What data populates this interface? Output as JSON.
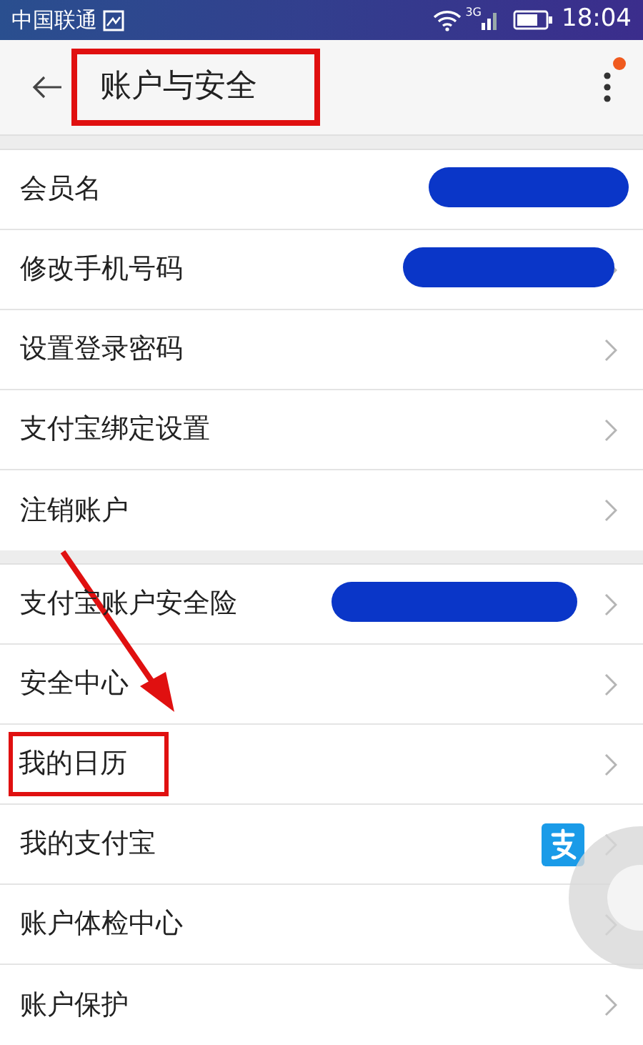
{
  "status_bar": {
    "carrier": "中国联通",
    "network": "3G",
    "time": "18:04"
  },
  "header": {
    "title": "账户与安全",
    "title_highlighted": true,
    "menu_badge": true
  },
  "groups": [
    {
      "rows": [
        {
          "label": "会员名",
          "redacted": true,
          "chevron": false,
          "highlighted": false,
          "alipay_icon": false
        },
        {
          "label": "修改手机号码",
          "redacted": true,
          "chevron": true,
          "highlighted": false,
          "alipay_icon": false
        },
        {
          "label": "设置登录密码",
          "redacted": false,
          "chevron": true,
          "highlighted": false,
          "alipay_icon": false
        },
        {
          "label": "支付宝绑定设置",
          "redacted": false,
          "chevron": true,
          "highlighted": false,
          "alipay_icon": false
        },
        {
          "label": "注销账户",
          "redacted": false,
          "chevron": true,
          "highlighted": false,
          "alipay_icon": false
        }
      ]
    },
    {
      "rows": [
        {
          "label": "支付宝账户安全险",
          "redacted": true,
          "chevron": true,
          "highlighted": false,
          "alipay_icon": false
        },
        {
          "label": "安全中心",
          "redacted": false,
          "chevron": true,
          "highlighted": false,
          "alipay_icon": false
        },
        {
          "label": "我的日历",
          "redacted": false,
          "chevron": true,
          "highlighted": true,
          "alipay_icon": false
        },
        {
          "label": "我的支付宝",
          "redacted": false,
          "chevron": true,
          "highlighted": false,
          "alipay_icon": true
        },
        {
          "label": "账户体检中心",
          "redacted": false,
          "chevron": true,
          "highlighted": false,
          "alipay_icon": false
        },
        {
          "label": "账户保护",
          "redacted": false,
          "chevron": true,
          "highlighted": false,
          "alipay_icon": false
        }
      ]
    }
  ]
}
